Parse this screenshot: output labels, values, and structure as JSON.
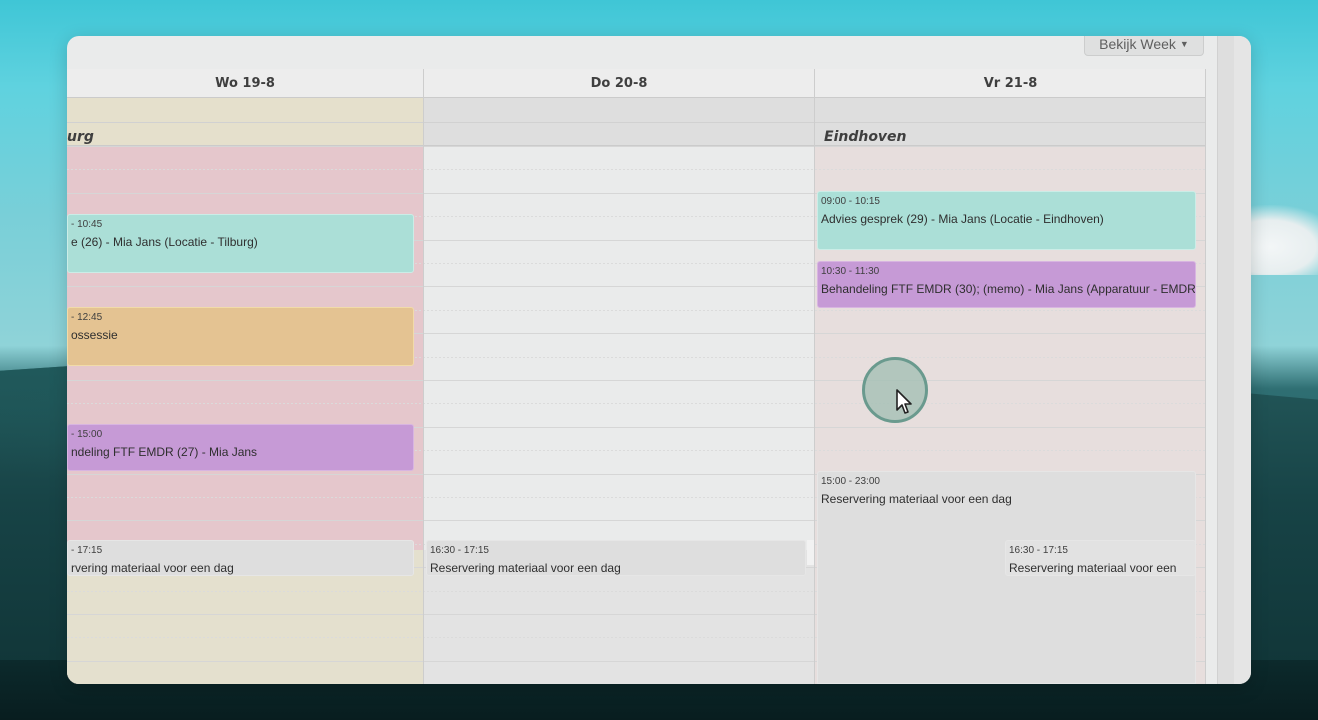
{
  "toolbar": {
    "view_label": "Bekijk Week"
  },
  "days": [
    {
      "label": "Wo 19-8",
      "allday_label": "urg"
    },
    {
      "label": "Do 20-8",
      "allday_label": ""
    },
    {
      "label": "Vr 21-8",
      "allday_label": "Eindhoven"
    }
  ],
  "events": {
    "wed": [
      {
        "time": "- 10:45",
        "desc": "e (26) - Mia Jans (Locatie - Tilburg)"
      },
      {
        "time": "- 12:45",
        "desc": "ossessie"
      },
      {
        "time": "- 15:00",
        "desc": "ndeling FTF EMDR (27) - Mia Jans"
      },
      {
        "time": "- 17:15",
        "desc": "rvering materiaal voor een dag"
      }
    ],
    "thu": [
      {
        "time": "16:30 - 17:15",
        "desc": "Reservering materiaal voor een dag"
      }
    ],
    "fri": [
      {
        "time": "09:00 - 10:15",
        "desc": "Advies gesprek (29) - Mia Jans (Locatie - Eindhoven)"
      },
      {
        "time": "10:30 - 11:30",
        "desc": "Behandeling FTF EMDR (30); (memo) - Mia Jans (Apparatuur - EMDR"
      },
      {
        "time": "15:00 - 23:00",
        "desc": "Reservering materiaal voor een dag"
      },
      {
        "time": "16:30 - 17:15",
        "desc": "Reservering materiaal voor een"
      }
    ]
  },
  "colors": {
    "teal": "#a6ddd5",
    "orange": "#e3c08c",
    "purple": "#c394d4",
    "gray": "#dcdcdc",
    "wed_bg": "#e4c4c9",
    "fri_bg": "#e6dcdb",
    "thu_bg": "#e9eaea"
  },
  "icons": {
    "cursor": "mouse-pointer-icon",
    "caret": "caret-down-icon"
  }
}
